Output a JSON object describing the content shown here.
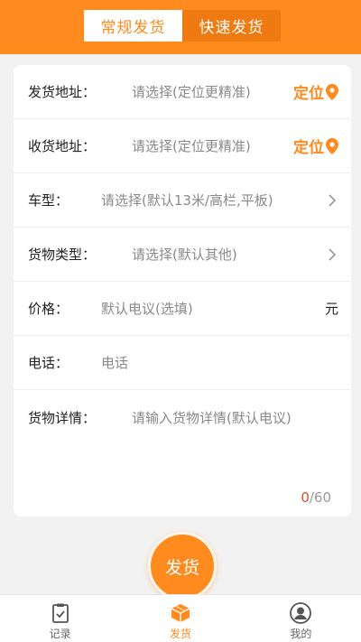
{
  "header": {
    "tabs": [
      {
        "label": "常规发货",
        "active": true
      },
      {
        "label": "快速发货",
        "active": false
      }
    ]
  },
  "form": {
    "origin": {
      "label": "发货地址：",
      "placeholder": "请选择(定位更精准)",
      "action": "定位"
    },
    "destination": {
      "label": "收货地址：",
      "placeholder": "请选择(定位更精准)",
      "action": "定位"
    },
    "truck_type": {
      "label": "车型：",
      "placeholder": "请选择(默认13米/高栏,平板)"
    },
    "cargo_type": {
      "label": "货物类型：",
      "placeholder": "请选择(默认其他)"
    },
    "price": {
      "label": "价格：",
      "placeholder": "默认电议(选填)",
      "unit": "元"
    },
    "phone": {
      "label": "电话：",
      "placeholder": "电话"
    },
    "details": {
      "label": "货物详情：",
      "placeholder": "请输入货物详情(默认电议)",
      "count": "0",
      "max": "/60"
    }
  },
  "submit_label": "发货",
  "tabbar": [
    {
      "label": "记录",
      "icon": "clipboard-icon",
      "active": false
    },
    {
      "label": "发货",
      "icon": "box-icon",
      "active": true
    },
    {
      "label": "我的",
      "icon": "user-icon",
      "active": false
    }
  ],
  "colors": {
    "accent": "#ff8a1e",
    "accent_dark": "#f07a12"
  }
}
